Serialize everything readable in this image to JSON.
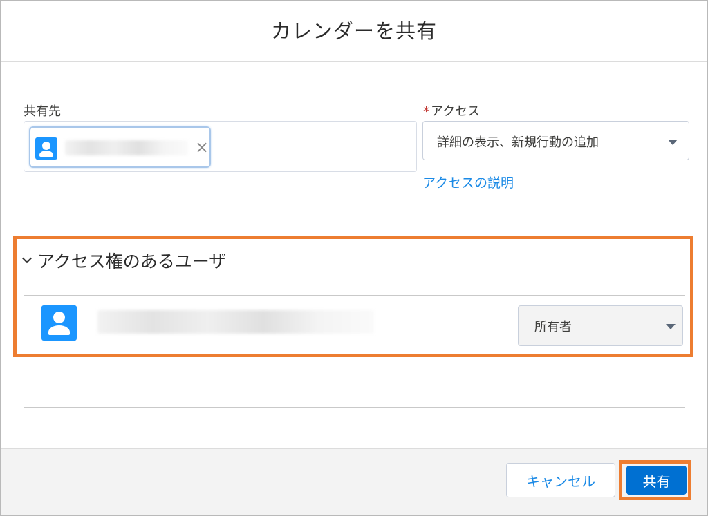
{
  "dialog": {
    "title": "カレンダーを共有"
  },
  "share_with": {
    "label": "共有先",
    "pill_icon": "user-icon",
    "remove_symbol": "×"
  },
  "access": {
    "required_marker": "*",
    "label": "アクセス",
    "selected_value": "詳細の表示、新規行動の追加",
    "help_link": "アクセスの説明"
  },
  "users_section": {
    "title": "アクセス権のあるユーザ",
    "expanded": true,
    "rows": [
      {
        "icon": "user-icon",
        "role": "所有者"
      }
    ]
  },
  "footer": {
    "cancel_label": "キャンセル",
    "share_label": "共有"
  },
  "colors": {
    "accent": "#0070d2",
    "link": "#1b8ae6",
    "avatar": "#1b96ff",
    "highlight": "#ed7d31"
  }
}
